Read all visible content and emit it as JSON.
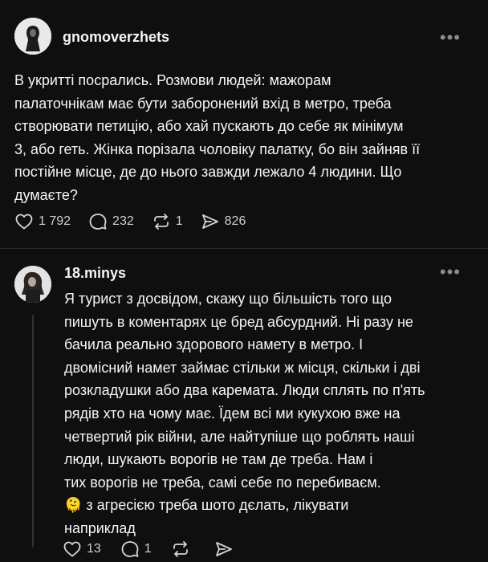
{
  "posts": [
    {
      "username": "gnomoverzhets",
      "text": "В укритті посрались. Розмови людей: мажорам\nпалаточнікам має бути заборонений вхід в метро, треба\nстворювати петицію, або хай пускають до себе як мінімум\n3, або геть. Жінка порізала чоловіку палатку, бо він зайняв її\nпостійне місце, де до нього завжди лежало 4 людини. Що\nдумаєте?",
      "likes": "1 792",
      "replies": "232",
      "reposts": "1",
      "shares": "826"
    },
    {
      "username": "18.minys",
      "text": "Я турист з досвідом, скажу що більшість того що\nпишуть в коментарях це бред абсурдний. Ні разу не\nбачила реально здорового намету в метро. І\nдвомісний намет займає стільки ж місця, скільки і дві\nрозкладушки або два каремата. Люди сплять по п'ять\nрядів хто на чому має. Їдем всі ми кукухою вже на\nчетвертий рік війни, але найтупіше що роблять наші\nлюди, шукають ворогів не там де треба. Нам і\nтих ворогів не треба, самі себе по перебиваєм.\n🫠 з агресією треба шото дєлать, лікувати\nнаприклад",
      "likes": "13",
      "replies": "1",
      "reposts": "",
      "shares": ""
    }
  ],
  "icons": {
    "more": "more-dots-icon",
    "like": "heart-icon",
    "reply": "comment-icon",
    "repost": "repost-icon",
    "share": "send-icon"
  },
  "colors": {
    "background": "#0f0f10",
    "text": "#f3f5f7",
    "muted": "#8a8a8e"
  }
}
